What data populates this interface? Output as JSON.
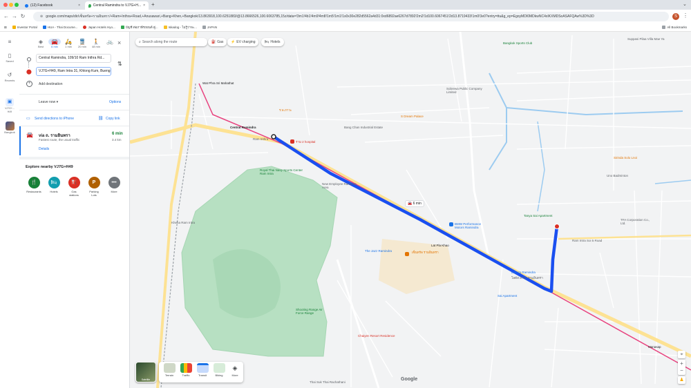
{
  "browser": {
    "tabs": [
      {
        "title": "(12) Facebook",
        "icon": "facebook-icon"
      },
      {
        "title": "Central Ramindra to VJ7G+H...",
        "icon": "google-maps-icon"
      }
    ],
    "new_tab": "+",
    "url": "google.com/maps/dir/เซ็นทรัล+รามอินทรา/+Ram+Inthra+Road,+Anusawari,+Bang+Khen,+Bangkok/13.863918,100.6251883/@13.8666526,100.6063785,15z/data=!3m1!4b1!4m9!4m8!1m5!1m1!1s0x30e282d5562a4d31:0xd6892ae6267d7892!2m2!1d100.6067451!2d13.8719433!1m0!3e0?entry=ttu&g_ep=EgoyMDI0MDkwNC4xIKXMDSoASAFQAw%3D%3D",
    "bookmarks": [
      "Investor Portal",
      "HUA - Thai Docume...",
      "Japan Hotels Hyo...",
      "บัญชี ต่อภาษีรถยนต์ คู่...",
      "Iskadog - ไม่รู้ว่าจะ...",
      "JAPAN"
    ],
    "all_bookmarks": "All Bookmarks",
    "profile_initial": "S"
  },
  "rail": {
    "menu_icon": "menu-icon",
    "items": [
      {
        "label": "Saved",
        "icon": "bookmark-icon"
      },
      {
        "label": "Recents",
        "icon": "history-icon"
      },
      {
        "label": "VJ7G+...\nH49",
        "icon": "place-icon"
      },
      {
        "label": "Bangkok",
        "icon": "city-thumb-icon"
      }
    ]
  },
  "directions": {
    "modes": [
      {
        "label": "Best",
        "icon": "best-route-icon"
      },
      {
        "label": "6 min",
        "icon": "car-icon"
      },
      {
        "label": "1 min",
        "icon": "motorcycle-icon"
      },
      {
        "label": "20 min",
        "icon": "transit-icon"
      },
      {
        "label": "48 min",
        "icon": "walk-icon"
      },
      {
        "label": "",
        "icon": "bicycle-icon"
      }
    ],
    "origin": "Central Ramindra, 109/10 Ram Inthra Rd...",
    "destination": "VJ7G+H49, Ram Intra 31, Khlong Kum, Bueng Kum, Bangkok",
    "add_destination": "Add destination",
    "leave_now": "Leave now",
    "options": "Options",
    "send_to_phone": "Send directions to iPhone",
    "copy_link": "Copy link",
    "route": {
      "via": "via ถ. รามอินทรา",
      "time": "6 min",
      "note": "Fastest route, the usual traffic",
      "distance": "3.4 km",
      "details": "Details"
    },
    "explore_title": "Explore nearby VJ7G+H49",
    "explore": [
      {
        "label": "Restaurants",
        "icon": "fork-knife-icon",
        "color": "#188038"
      },
      {
        "label": "Hotels",
        "icon": "bed-icon",
        "color": "#129eaf"
      },
      {
        "label": "Gas stations",
        "icon": "gas-pump-icon",
        "color": "#d93025"
      },
      {
        "label": "Parking Lots",
        "icon": "parking-icon",
        "color": "#b06000"
      },
      {
        "label": "More",
        "icon": "more-dots-icon",
        "color": "#70757a"
      }
    ]
  },
  "map": {
    "search_placeholder": "Search along the route",
    "chips": [
      "Gas",
      "EV charging",
      "Hotels"
    ],
    "route_badge": "6 min",
    "route_color": "#1a4ff0",
    "rail_color": "#e8437f",
    "labels": {
      "wat_phra": "Wat Phra Sri Mahathat",
      "central": "Central Ramindra",
      "ramintra": "Ram Inthra",
      "km2": "ร.พ.ภาวะ",
      "km2b": "ราม 2 hospital",
      "royal_sports": "Royal Thai Navy Sports Center Ram Intra",
      "bangkok": "Bangkok",
      "sdream": "S Dream Palace",
      "sobrewa": "Sobrewa Public Company Limited",
      "new_roots": "New Employee Ramintra Area",
      "bmw": "BMW Performance Motors Ramindra",
      "lat_pla": "Lat Pla Khao",
      "lotus": "Lotus's Ramindra",
      "lotus2": "โลตัส สาขา รามอินทรา",
      "the_jazz": "The Jazz Ramindra",
      "central2": "เซ็นทรัล รามอินทรา",
      "sai_apt": "Sai Apartment",
      "fa": "TFA Corporation Co., Ltd.",
      "uno": "Uno Badminton",
      "shooting": "Shooting Range Air Force Range",
      "chaiyen": "Chaiyen Resort Residence",
      "thai_suk": "Thai Suk Thai Rachathani",
      "bangkok_sport": "Bangkok Sports Club",
      "villa": "Suppasi Pilaa Villa Mae Ya",
      "minburi": "Sirinda Solo Lnoi",
      "gate": "Manasap",
      "tanya": "Tanya Sai Apartment",
      "cs": "Ram Intra Soi 5 Road",
      "udom": "Bang Chan Industrial Estate",
      "kheha": "Kheha Ram Intra"
    },
    "layers": [
      {
        "label": "Terrain",
        "icon": "terrain-icon"
      },
      {
        "label": "Traffic",
        "icon": "traffic-icon"
      },
      {
        "label": "Transit",
        "icon": "transit-layer-icon"
      },
      {
        "label": "Biking",
        "icon": "biking-icon"
      },
      {
        "label": "More",
        "icon": "layers-more-icon"
      }
    ],
    "satellite": "Satellite",
    "google": "Google",
    "scale": "200 m"
  }
}
